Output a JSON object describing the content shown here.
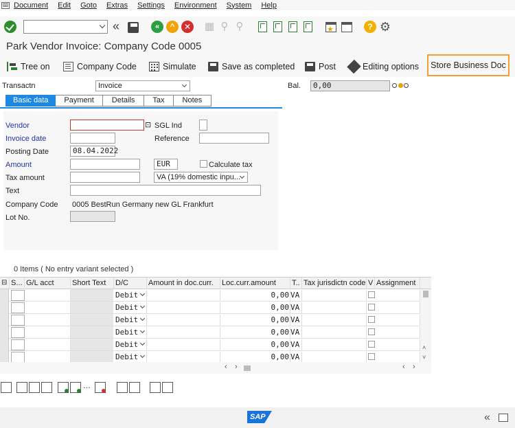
{
  "menu": [
    "Document",
    "Edit",
    "Goto",
    "Extras",
    "Settings",
    "Environment",
    "System",
    "Help"
  ],
  "title": "Park Vendor Invoice: Company Code 0005",
  "app_toolbar": {
    "tree_on": "Tree on",
    "company_code": "Company Code",
    "simulate": "Simulate",
    "save_completed": "Save as completed",
    "post": "Post",
    "editing_options": "Editing options",
    "store_business_doc": "Store Business Doc"
  },
  "header": {
    "transactn_label": "Transactn",
    "transactn_value": "Invoice",
    "bal_label": "Bal.",
    "bal_value": "0,00"
  },
  "tabs": [
    "Basic data",
    "Payment",
    "Details",
    "Tax",
    "Notes"
  ],
  "active_tab": "Basic data",
  "form": {
    "vendor_label": "Vendor",
    "vendor_value": "",
    "sgl_label": "SGL Ind",
    "invoice_date_label": "Invoice date",
    "reference_label": "Reference",
    "posting_date_label": "Posting Date",
    "posting_date_value": "08.04.2022",
    "amount_label": "Amount",
    "currency_value": "EUR",
    "calc_tax_label": "Calculate tax",
    "tax_amount_label": "Tax amount",
    "tax_code_value": "VA (19% domestic inpu...",
    "text_label": "Text",
    "company_code_label": "Company Code",
    "company_code_value": "0005 BestRun Germany new GL Frankfurt",
    "lot_no_label": "Lot No."
  },
  "items": {
    "summary": "0 Items ( No entry variant selected )",
    "columns": [
      "S...",
      "G/L acct",
      "Short Text",
      "D/C",
      "Amount in doc.curr.",
      "Loc.curr.amount",
      "T..",
      "Tax jurisdictn code",
      "V",
      "Assignment"
    ],
    "rows": [
      {
        "dc": "Debit",
        "loc": "0,00",
        "tax": "VA"
      },
      {
        "dc": "Debit",
        "loc": "0,00",
        "tax": "VA"
      },
      {
        "dc": "Debit",
        "loc": "0,00",
        "tax": "VA"
      },
      {
        "dc": "Debit",
        "loc": "0,00",
        "tax": "VA"
      },
      {
        "dc": "Debit",
        "loc": "0,00",
        "tax": "VA"
      },
      {
        "dc": "Debit",
        "loc": "0,00",
        "tax": "VA"
      }
    ]
  },
  "status": {
    "logo_text": "SAP"
  }
}
